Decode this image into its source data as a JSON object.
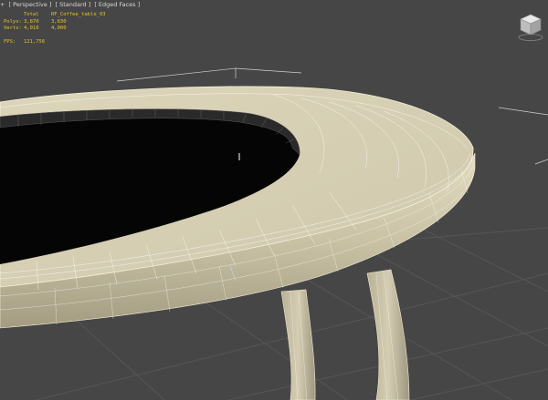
{
  "viewport": {
    "label_parts": [
      "+",
      "[ Perspective ]",
      "[ Standard ]",
      "[ Edged Faces ]"
    ],
    "stats": {
      "header": {
        "col1": "",
        "col2": "Total",
        "col3": "RF_Coffee_table_03"
      },
      "rows": [
        {
          "label": "Polys:",
          "total": "3,870",
          "selected": "3,830"
        },
        {
          "label": "Verts:",
          "total": "4,010",
          "selected": "4,000"
        }
      ],
      "fps": {
        "label": "FPS:",
        "value": "121,756"
      }
    }
  },
  "colors": {
    "background": "#464646",
    "grid": "#5a5a5a",
    "table_surface": "#d6cfb5",
    "table_edge_highlight": "#efe8cc",
    "table_shadow": "#8f8870",
    "hole": "#050505",
    "wire": "#ffffff",
    "stats_text": "#e6c42a"
  },
  "icons": {
    "viewcube": "viewcube-icon",
    "gizmo": "transform-gizmo-icon"
  }
}
